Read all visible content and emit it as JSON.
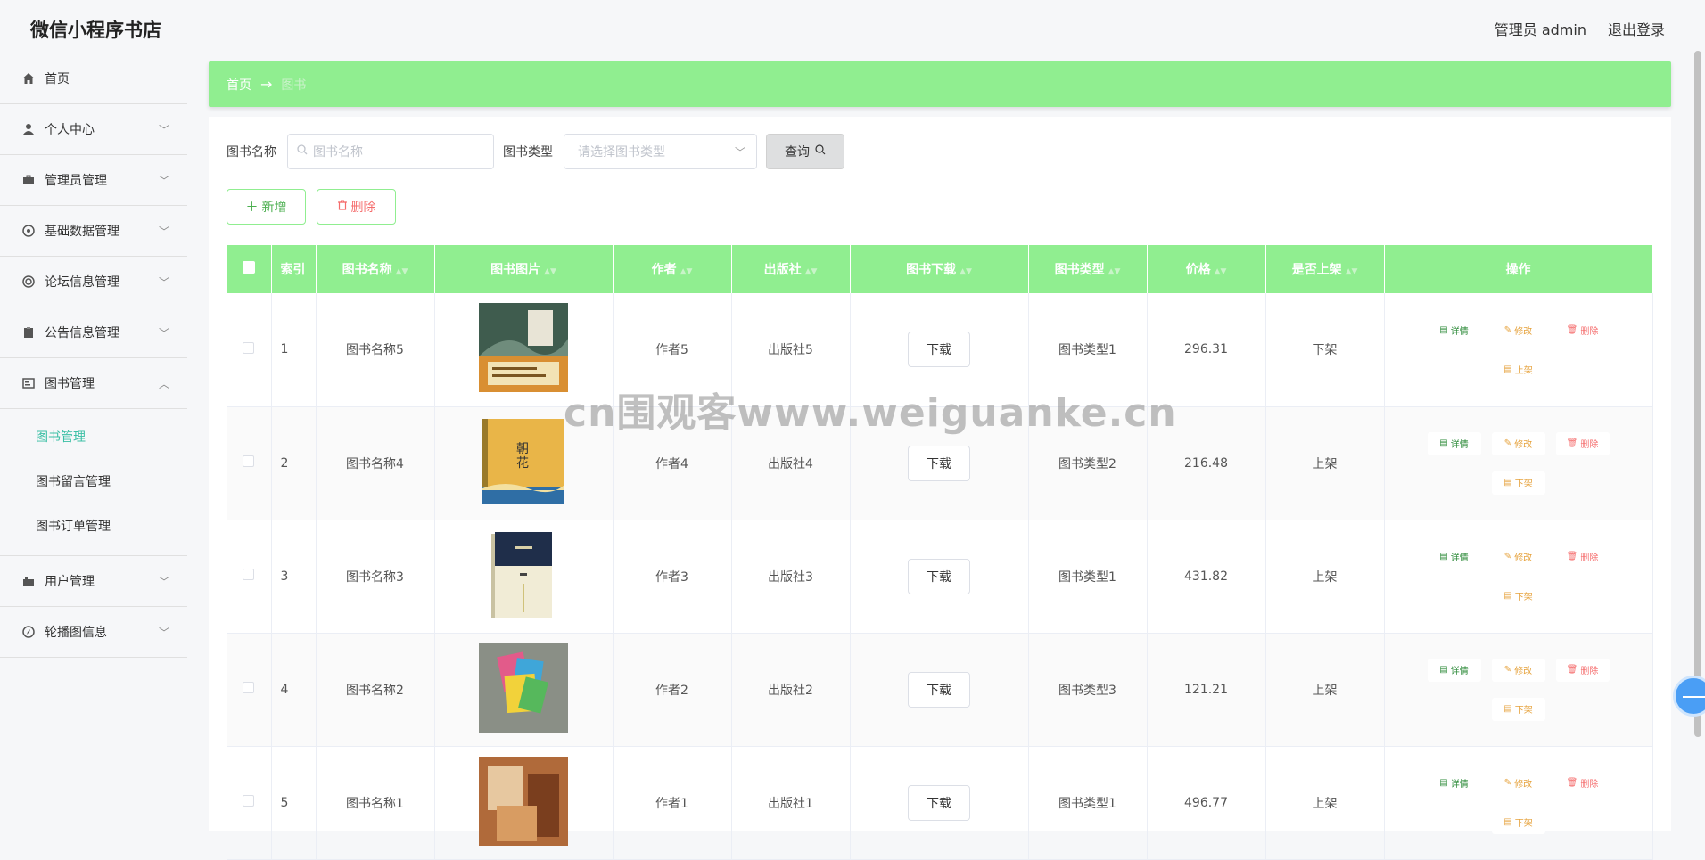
{
  "app": {
    "title": "微信小程序书店"
  },
  "header": {
    "admin_label": "管理员 admin",
    "logout_label": "退出登录"
  },
  "sidebar": {
    "items": [
      {
        "label": "首页",
        "icon": "home-icon"
      },
      {
        "label": "个人中心",
        "icon": "user-icon"
      },
      {
        "label": "管理员管理",
        "icon": "briefcase-icon"
      },
      {
        "label": "基础数据管理",
        "icon": "aperture-icon"
      },
      {
        "label": "论坛信息管理",
        "icon": "ring-icon"
      },
      {
        "label": "公告信息管理",
        "icon": "clipboard-icon"
      },
      {
        "label": "图书管理",
        "icon": "card-icon"
      },
      {
        "label": "用户管理",
        "icon": "suitcase-icon"
      },
      {
        "label": "轮播图信息",
        "icon": "compass-icon"
      }
    ],
    "book_submenu": [
      {
        "label": "图书管理"
      },
      {
        "label": "图书留言管理"
      },
      {
        "label": "图书订单管理"
      }
    ]
  },
  "breadcrumb": {
    "home": "首页",
    "current": "图书"
  },
  "search": {
    "name_label": "图书名称",
    "name_placeholder": "图书名称",
    "type_label": "图书类型",
    "type_placeholder": "请选择图书类型",
    "query_label": "查询"
  },
  "actions": {
    "add_label": "新增",
    "delete_label": "删除"
  },
  "table": {
    "headers": [
      "索引",
      "图书名称",
      "图书图片",
      "作者",
      "出版社",
      "图书下载",
      "图书类型",
      "价格",
      "是否上架",
      "操作"
    ],
    "download_label": "下载",
    "op_labels": {
      "detail": "详情",
      "edit": "修改",
      "delete": "删除",
      "up": "上架",
      "down": "下架"
    },
    "rows": [
      {
        "index": "1",
        "name": "图书名称5",
        "author": "作者5",
        "publisher": "出版社5",
        "type": "图书类型1",
        "price": "296.31",
        "status": "下架",
        "shelf_op": "上架"
      },
      {
        "index": "2",
        "name": "图书名称4",
        "author": "作者4",
        "publisher": "出版社4",
        "type": "图书类型2",
        "price": "216.48",
        "status": "上架",
        "shelf_op": "下架"
      },
      {
        "index": "3",
        "name": "图书名称3",
        "author": "作者3",
        "publisher": "出版社3",
        "type": "图书类型1",
        "price": "431.82",
        "status": "上架",
        "shelf_op": "下架"
      },
      {
        "index": "4",
        "name": "图书名称2",
        "author": "作者2",
        "publisher": "出版社2",
        "type": "图书类型3",
        "price": "121.21",
        "status": "上架",
        "shelf_op": "下架"
      },
      {
        "index": "5",
        "name": "图书名称1",
        "author": "作者1",
        "publisher": "出版社1",
        "type": "图书类型1",
        "price": "496.77",
        "status": "上架",
        "shelf_op": "下架"
      }
    ]
  },
  "watermark": "cn围观客www.weiguanke.cn",
  "colors": {
    "accent_green": "#90ee90",
    "active_menu": "#3bbfa5",
    "danger": "#f56c6c",
    "warning": "#e6a23c"
  }
}
